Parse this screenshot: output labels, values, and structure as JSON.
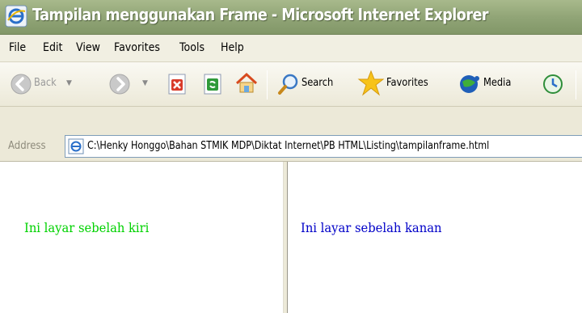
{
  "window": {
    "title": "Tampilan menggunakan Frame - Microsoft Internet Explorer",
    "icon": "ie-icon"
  },
  "menubar": {
    "items": [
      {
        "label": "File"
      },
      {
        "label": "Edit"
      },
      {
        "label": "View"
      },
      {
        "label": "Favorites"
      },
      {
        "label": "Tools"
      },
      {
        "label": "Help"
      }
    ]
  },
  "toolbar": {
    "back_label": "Back",
    "search_label": "Search",
    "favorites_label": "Favorites",
    "media_label": "Media"
  },
  "address": {
    "label": "Address",
    "value": "C:\\Henky Honggo\\Bahan STMIK MDP\\Diktat Internet\\PB HTML\\Listing\\tampilanframe.html"
  },
  "frames": {
    "left_text": "Ini layar sebelah kiri",
    "left_color": "#00d200",
    "right_text": "Ini layar sebelah kanan",
    "right_color": "#0000c8"
  }
}
